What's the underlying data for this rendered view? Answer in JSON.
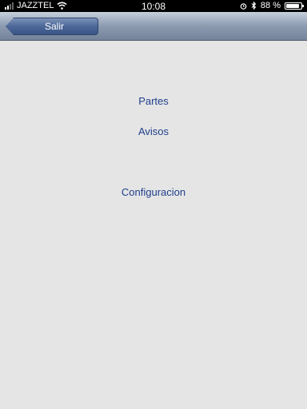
{
  "status_bar": {
    "carrier": "JAZZTEL",
    "time": "10:08",
    "battery_percent": "88 %",
    "battery_level": 0.88
  },
  "nav": {
    "back_label": "Salir"
  },
  "menu": {
    "partes": "Partes",
    "avisos": "Avisos",
    "configuracion": "Configuracion"
  }
}
